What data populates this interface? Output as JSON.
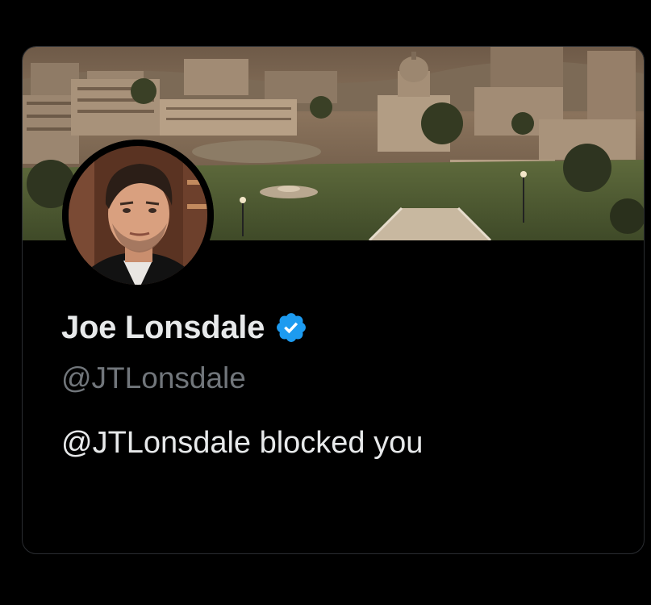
{
  "profile": {
    "display_name": "Joe Lonsdale",
    "verified_icon": "verified-badge-icon",
    "handle": "@JTLonsdale",
    "blocked_message": "@JTLonsdale blocked you",
    "banner_image": "city-campus-banner",
    "avatar_image": "profile-photo"
  },
  "colors": {
    "background": "#000000",
    "text_primary": "#e7e9ea",
    "text_secondary": "#71767b",
    "verified_blue": "#1d9bf0",
    "card_border": "#2a2d31"
  }
}
